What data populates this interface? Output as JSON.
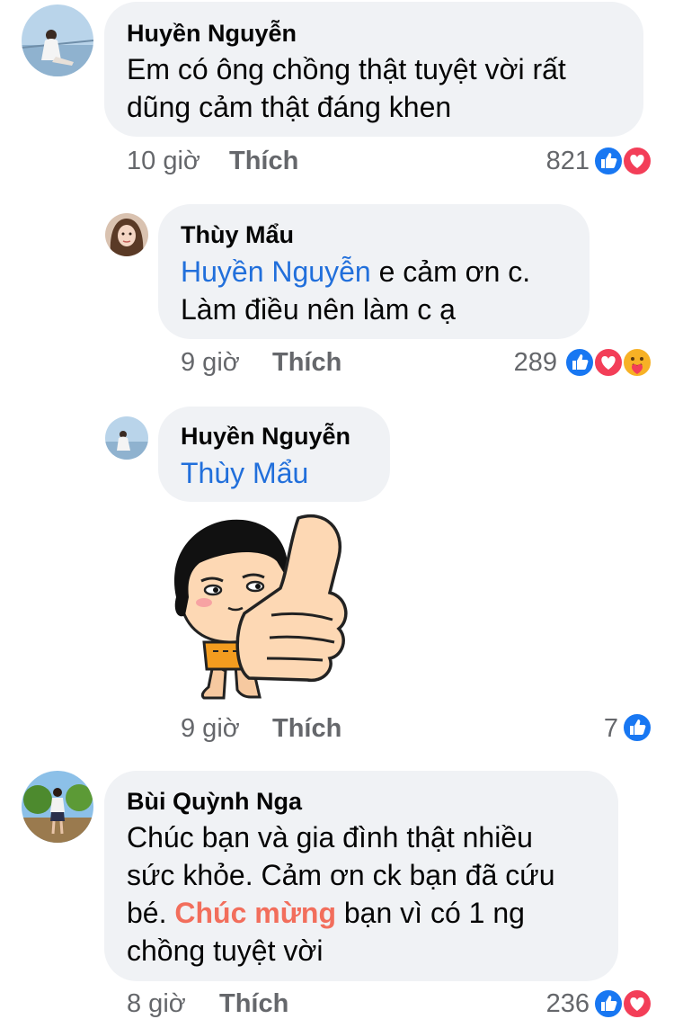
{
  "comments": [
    {
      "author": "Huyền Nguyễn",
      "lines": [
        "Em có ông chồng thật tuyệt vời rất",
        "dũng cảm thật đáng khen"
      ],
      "time": "10 giờ",
      "like_label": "Thích",
      "reaction_count": "821",
      "reactions": [
        "like-icon",
        "love-icon"
      ]
    },
    {
      "author": "Thùy Mẩu",
      "mention": "Huyền Nguyễn",
      "line1_rest": " e cảm ơn c.",
      "line2": "Làm điều nên làm c ạ",
      "time": "9 giờ",
      "like_label": "Thích",
      "reaction_count": "289",
      "reactions": [
        "like-icon",
        "love-icon",
        "care-icon"
      ]
    },
    {
      "author": "Huyền Nguyễn",
      "mention": "Thùy Mẩu",
      "sticker": "thumbs-up-girl-sticker",
      "time": "9 giờ",
      "like_label": "Thích",
      "reaction_count": "7",
      "reactions": [
        "like-icon"
      ]
    },
    {
      "author": "Bùi Quỳnh Nga",
      "line1": "Chúc bạn và gia đình thật nhiều",
      "line2": "sức khỏe. Cảm ơn ck bạn đã cứu",
      "line3_pre": "bé. ",
      "line3_hl": "Chúc mừng",
      "line3_post": " bạn vì có 1 ng",
      "line4": "chồng tuyệt vời",
      "time": "8 giờ",
      "like_label": "Thích",
      "reaction_count": "236",
      "reactions": [
        "like-icon",
        "love-icon"
      ]
    }
  ],
  "colors": {
    "bubble": "#f0f2f5",
    "mention": "#216fdb",
    "highlight": "#f26e5c",
    "meta": "#65676b",
    "like": "#1877f2",
    "love": "#f33e58"
  }
}
